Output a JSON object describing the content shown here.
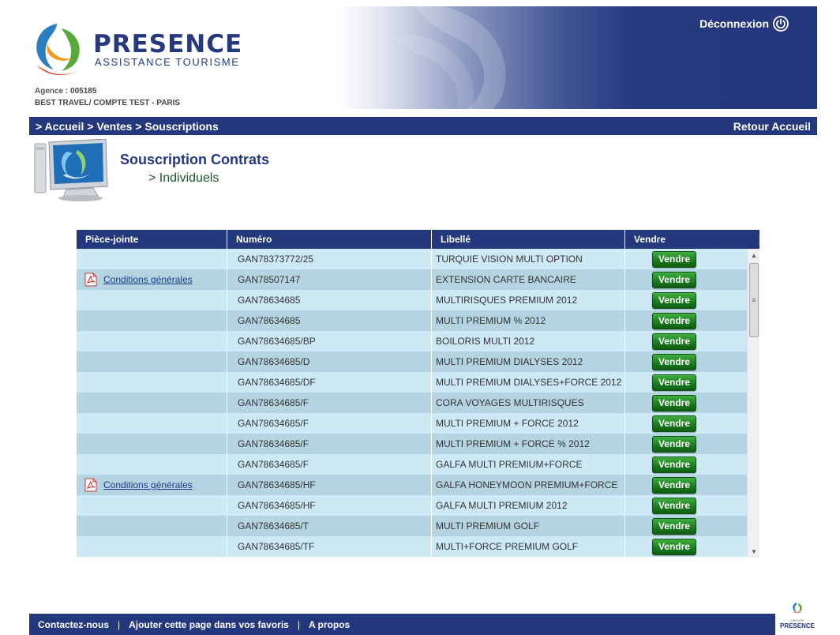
{
  "brand": {
    "title": "PRESENCE",
    "subtitle": "ASSISTANCE TOURISME",
    "group_small": "GROUPE",
    "group_name": "PRESENCE"
  },
  "agency": {
    "label": "Agence :",
    "code": "005185",
    "name": "BEST TRAVEL/ COMPTE TEST - PARIS"
  },
  "header": {
    "logout_label": "Déconnexion"
  },
  "breadcrumb": {
    "items": [
      "> Accueil",
      "> Ventes",
      "> Souscriptions"
    ],
    "home_return": "Retour Accueil"
  },
  "page": {
    "title": "Souscription Contrats",
    "subtitle": "> Individuels"
  },
  "table": {
    "columns": [
      "Pièce-jointe",
      "Numéro",
      "Libellé",
      "Vendre"
    ],
    "attachment_label": "Conditions générales",
    "sell_label": "Vendre",
    "rows": [
      {
        "attachment": false,
        "number": "GAN78373772/25",
        "label": "TURQUIE VISION MULTI OPTION"
      },
      {
        "attachment": true,
        "number": "GAN78507147",
        "label": "EXTENSION CARTE BANCAIRE"
      },
      {
        "attachment": false,
        "number": "GAN78634685",
        "label": "MULTIRISQUES PREMIUM 2012"
      },
      {
        "attachment": false,
        "number": "GAN78634685",
        "label": "MULTI PREMIUM % 2012"
      },
      {
        "attachment": false,
        "number": "GAN78634685/BP",
        "label": "BOILORIS MULTI 2012"
      },
      {
        "attachment": false,
        "number": "GAN78634685/D",
        "label": "MULTI PREMIUM DIALYSES 2012"
      },
      {
        "attachment": false,
        "number": "GAN78634685/DF",
        "label": "MULTI PREMIUM DIALYSES+FORCE 2012"
      },
      {
        "attachment": false,
        "number": "GAN78634685/F",
        "label": "CORA VOYAGES MULTIRISQUES"
      },
      {
        "attachment": false,
        "number": "GAN78634685/F",
        "label": "MULTI PREMIUM + FORCE 2012"
      },
      {
        "attachment": false,
        "number": "GAN78634685/F",
        "label": "MULTI PREMIUM + FORCE % 2012"
      },
      {
        "attachment": false,
        "number": "GAN78634685/F",
        "label": "GALFA MULTI PREMIUM+FORCE"
      },
      {
        "attachment": true,
        "number": "GAN78634685/HF",
        "label": "GALFA HONEYMOON PREMIUM+FORCE"
      },
      {
        "attachment": false,
        "number": "GAN78634685/HF",
        "label": "GALFA MULTI PREMIUM 2012"
      },
      {
        "attachment": false,
        "number": "GAN78634685/T",
        "label": "MULTI PREMIUM GOLF"
      },
      {
        "attachment": false,
        "number": "GAN78634685/TF",
        "label": "MULTI+FORCE PREMIUM GOLF"
      }
    ]
  },
  "footer": {
    "links": [
      "Contactez-nous",
      "Ajouter cette page dans vos favoris",
      "A propos"
    ],
    "separator": "|"
  },
  "colors": {
    "brand_navy": "#24387e",
    "row_light": "#cde9f6",
    "row_dark": "#b5d4e2",
    "button_green": "#1c7d20",
    "subtitle_green": "#1a5a2a"
  },
  "icons": [
    "power-icon",
    "presence-logo-icon",
    "computer-icon",
    "pdf-icon"
  ]
}
